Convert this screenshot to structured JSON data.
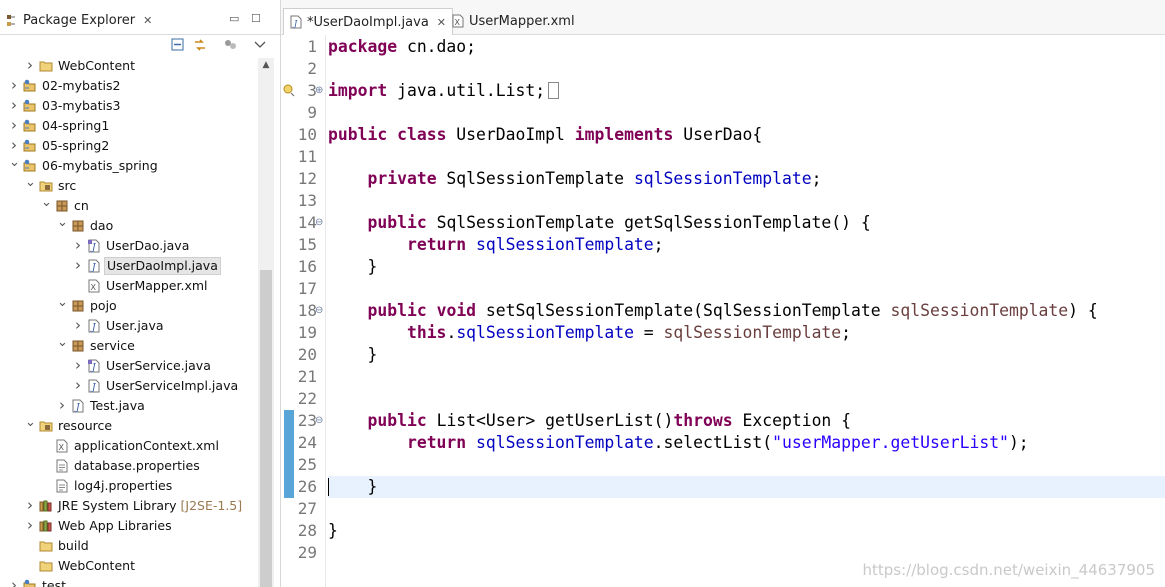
{
  "package_explorer": {
    "title": "Package Explorer",
    "tree": [
      {
        "label": "WebContent",
        "indent": 1,
        "icon": "folder-icon",
        "arrow": "collapsed"
      },
      {
        "label": "02-mybatis2",
        "indent": 0,
        "icon": "project-icon",
        "arrow": "collapsed"
      },
      {
        "label": "03-mybatis3",
        "indent": 0,
        "icon": "project-icon",
        "arrow": "collapsed"
      },
      {
        "label": "04-spring1",
        "indent": 0,
        "icon": "project-icon",
        "arrow": "collapsed"
      },
      {
        "label": "05-spring2",
        "indent": 0,
        "icon": "project-icon",
        "arrow": "collapsed"
      },
      {
        "label": "06-mybatis_spring",
        "indent": 0,
        "icon": "project-icon",
        "arrow": "expanded"
      },
      {
        "label": "src",
        "indent": 1,
        "icon": "source-folder-icon",
        "arrow": "expanded"
      },
      {
        "label": "cn",
        "indent": 2,
        "icon": "package-icon",
        "arrow": "expanded"
      },
      {
        "label": "dao",
        "indent": 3,
        "icon": "package-icon",
        "arrow": "expanded"
      },
      {
        "label": "UserDao.java",
        "indent": 4,
        "icon": "java-interface-file-icon",
        "arrow": "collapsed"
      },
      {
        "label": "UserDaoImpl.java",
        "indent": 4,
        "icon": "java-file-icon",
        "arrow": "collapsed",
        "selected": true
      },
      {
        "label": "UserMapper.xml",
        "indent": 4,
        "icon": "xml-file-icon",
        "arrow": "none"
      },
      {
        "label": "pojo",
        "indent": 3,
        "icon": "package-icon",
        "arrow": "expanded"
      },
      {
        "label": "User.java",
        "indent": 4,
        "icon": "java-file-icon",
        "arrow": "collapsed"
      },
      {
        "label": "service",
        "indent": 3,
        "icon": "package-icon",
        "arrow": "expanded"
      },
      {
        "label": "UserService.java",
        "indent": 4,
        "icon": "java-interface-file-icon",
        "arrow": "collapsed"
      },
      {
        "label": "UserServiceImpl.java",
        "indent": 4,
        "icon": "java-file-icon",
        "arrow": "collapsed"
      },
      {
        "label": "Test.java",
        "indent": 3,
        "icon": "java-file-icon",
        "arrow": "collapsed"
      },
      {
        "label": "resource",
        "indent": 1,
        "icon": "source-folder-icon",
        "arrow": "expanded"
      },
      {
        "label": "applicationContext.xml",
        "indent": 2,
        "icon": "xml-file-icon",
        "arrow": "none"
      },
      {
        "label": "database.properties",
        "indent": 2,
        "icon": "properties-file-icon",
        "arrow": "none"
      },
      {
        "label": "log4j.properties",
        "indent": 2,
        "icon": "properties-file-icon",
        "arrow": "none"
      },
      {
        "label": "JRE System Library",
        "decoration": "[J2SE-1.5]",
        "indent": 1,
        "icon": "library-icon",
        "arrow": "collapsed"
      },
      {
        "label": "Web App Libraries",
        "indent": 1,
        "icon": "library-icon",
        "arrow": "collapsed"
      },
      {
        "label": "build",
        "indent": 1,
        "icon": "folder-icon",
        "arrow": "none"
      },
      {
        "label": "WebContent",
        "indent": 1,
        "icon": "folder-icon",
        "arrow": "none"
      },
      {
        "label": "test",
        "indent": 0,
        "icon": "project-icon",
        "arrow": "collapsed"
      }
    ]
  },
  "editor": {
    "tabs": [
      {
        "label": "*UserDaoImpl.java",
        "active": true,
        "icon": "java-file-icon"
      },
      {
        "label": "UserMapper.xml",
        "active": false,
        "icon": "xml-file-icon"
      }
    ],
    "line_numbers": [
      "1",
      "2",
      "3",
      "9",
      "10",
      "11",
      "12",
      "13",
      "14",
      "15",
      "16",
      "17",
      "18",
      "19",
      "20",
      "21",
      "22",
      "23",
      "24",
      "25",
      "26",
      "27",
      "28",
      "29"
    ],
    "folded_import_marker": "⊕",
    "fold_marker": "⊖",
    "code": [
      [
        {
          "t": "package",
          "c": "kw"
        },
        {
          "t": " cn.dao;"
        }
      ],
      [],
      [
        {
          "t": "import",
          "c": "kw"
        },
        {
          "t": " java.util.List;"
        }
      ],
      [],
      [
        {
          "t": "public",
          "c": "kw"
        },
        {
          "t": " "
        },
        {
          "t": "class",
          "c": "kw"
        },
        {
          "t": " UserDaoImpl "
        },
        {
          "t": "implements",
          "c": "kw"
        },
        {
          "t": " UserDao{"
        }
      ],
      [],
      [
        {
          "t": "    "
        },
        {
          "t": "private",
          "c": "kw"
        },
        {
          "t": " SqlSessionTemplate "
        },
        {
          "t": "sqlSessionTemplate",
          "c": "fd"
        },
        {
          "t": ";"
        }
      ],
      [],
      [
        {
          "t": "    "
        },
        {
          "t": "public",
          "c": "kw"
        },
        {
          "t": " SqlSessionTemplate getSqlSessionTemplate() {"
        }
      ],
      [
        {
          "t": "        "
        },
        {
          "t": "return",
          "c": "kw"
        },
        {
          "t": " "
        },
        {
          "t": "sqlSessionTemplate",
          "c": "fd"
        },
        {
          "t": ";"
        }
      ],
      [
        {
          "t": "    }"
        }
      ],
      [],
      [
        {
          "t": "    "
        },
        {
          "t": "public",
          "c": "kw"
        },
        {
          "t": " "
        },
        {
          "t": "void",
          "c": "kw"
        },
        {
          "t": " setSqlSessionTemplate(SqlSessionTemplate "
        },
        {
          "t": "sqlSessionTemplate",
          "c": "pm"
        },
        {
          "t": ") {"
        }
      ],
      [
        {
          "t": "        "
        },
        {
          "t": "this",
          "c": "kw"
        },
        {
          "t": "."
        },
        {
          "t": "sqlSessionTemplate",
          "c": "fd"
        },
        {
          "t": " = "
        },
        {
          "t": "sqlSessionTemplate",
          "c": "pm"
        },
        {
          "t": ";"
        }
      ],
      [
        {
          "t": "    }"
        }
      ],
      [],
      [],
      [
        {
          "t": "    "
        },
        {
          "t": "public",
          "c": "kw"
        },
        {
          "t": " List<User> getUserList()"
        },
        {
          "t": "throws",
          "c": "kw"
        },
        {
          "t": " Exception {"
        }
      ],
      [
        {
          "t": "        "
        },
        {
          "t": "return",
          "c": "kw"
        },
        {
          "t": " "
        },
        {
          "t": "sqlSessionTemplate",
          "c": "fd"
        },
        {
          "t": ".selectList("
        },
        {
          "t": "\"userMapper.getUserList\"",
          "c": "str"
        },
        {
          "t": ");"
        }
      ],
      [],
      [
        {
          "t": "    }"
        }
      ],
      [],
      [
        {
          "t": "}"
        }
      ],
      []
    ]
  },
  "watermark": "https://blog.csdn.net/weixin_44637905"
}
